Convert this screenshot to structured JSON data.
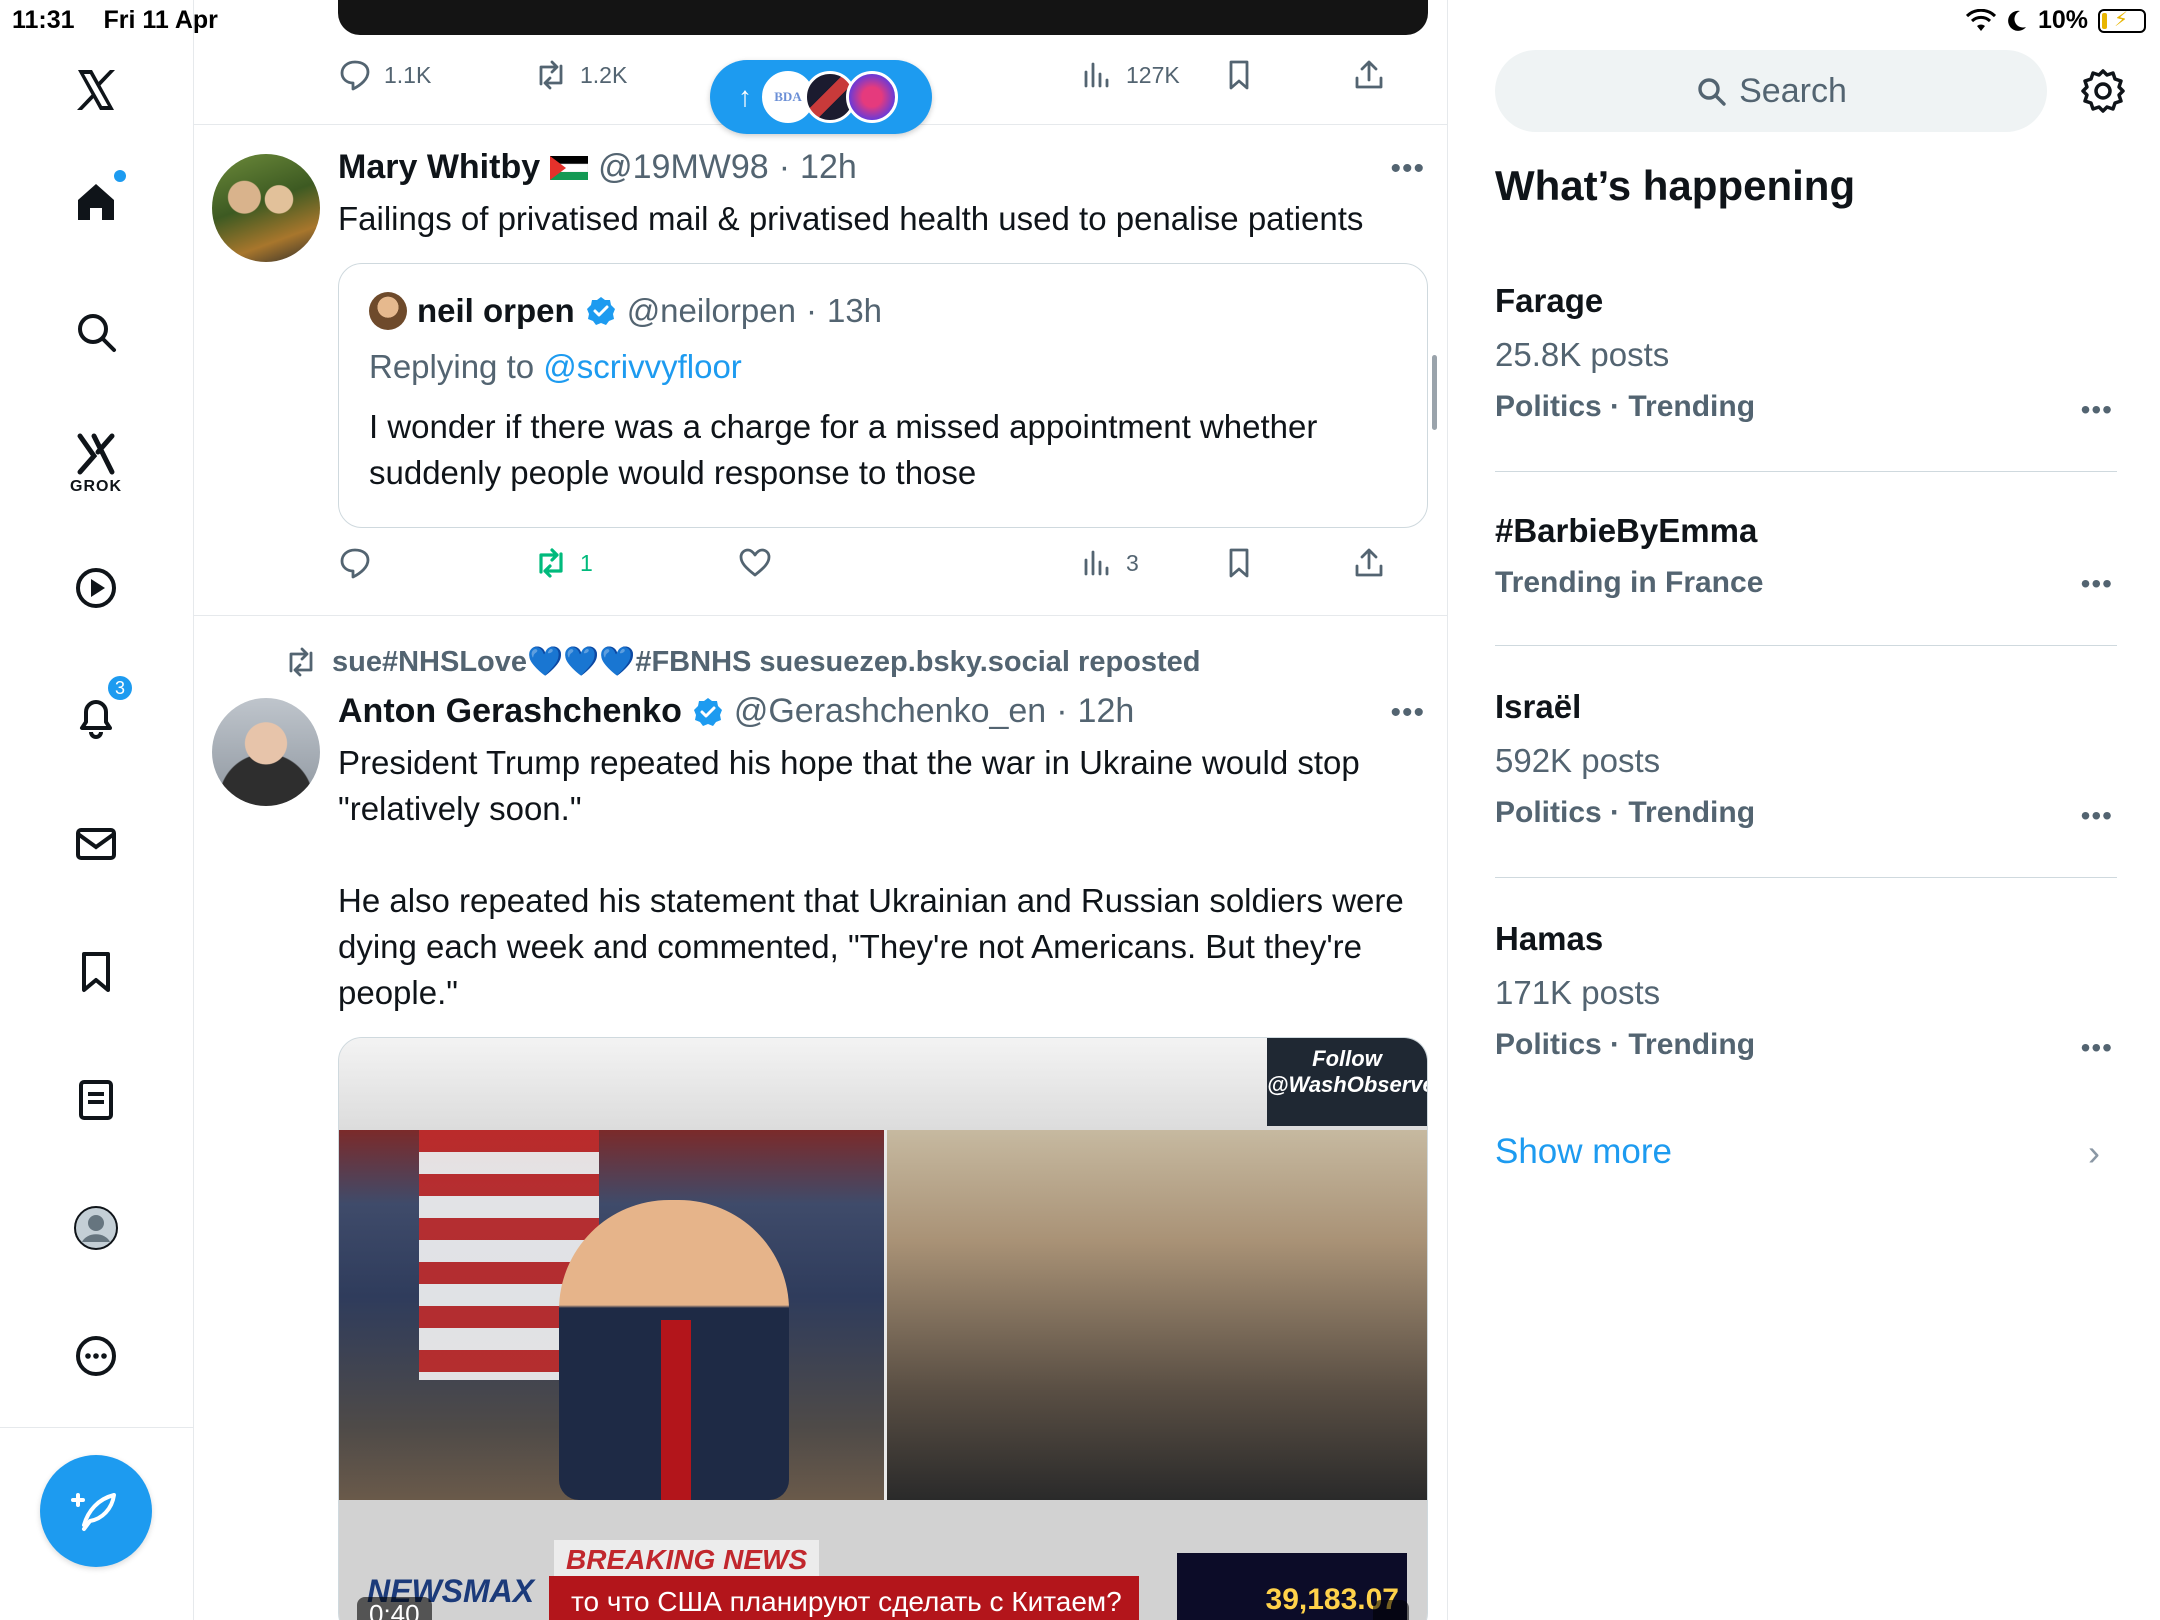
{
  "status_bar": {
    "time": "11:31",
    "date": "Fri 11 Apr",
    "battery": "10%"
  },
  "nav": {
    "grok_label": "GROK",
    "notifications_badge": "3",
    "items": [
      "home-icon",
      "search-icon",
      "grok-icon",
      "video-icon",
      "bell-icon",
      "mail-icon",
      "bookmark-icon",
      "lists-icon",
      "profile-icon",
      "more-icon"
    ]
  },
  "feed": {
    "top_actions": {
      "replies": "1.1K",
      "reposts": "1.2K",
      "views": "127K"
    },
    "tweet1": {
      "name": "Mary Whitby",
      "handle": "@19MW98",
      "time": "12h",
      "text": "Failings of privatised mail & privatised health used to penalise patients",
      "quote": {
        "name": "neil orpen",
        "handle": "@neilorpen",
        "time": "13h",
        "replying_prefix": "Replying to",
        "replying_to": "@scrivvyfloor",
        "text": "I wonder if there was a charge for a missed appointment whether suddenly people would response to those"
      },
      "actions": {
        "reposts": "1",
        "views": "3"
      }
    },
    "tweet2": {
      "repost_by": "sue#NHSLove💙💙💙#FBNHS suesuezep.bsky.social reposted",
      "name": "Anton Gerashchenko",
      "handle": "@Gerashchenko_en",
      "time": "12h",
      "text_p1": "President Trump repeated his hope that the war in Ukraine would stop \"relatively soon.\"",
      "text_p2": "He also repeated his statement that Ukrainian and Russian soldiers were dying each week and commented, \"They're not Americans. But they're people.\"",
      "media": {
        "breaking": "BREAKING NEWS",
        "network": "NEWSMAX",
        "chyron": "то что США планируют сделать с Китаем?",
        "ticker": "39,183.07",
        "follow": "Follow @WashObserver",
        "duration": "0:40"
      }
    }
  },
  "new_posts_pill": {
    "avatar1": "BDA"
  },
  "sidebar": {
    "search_placeholder": "Search",
    "title": "What’s happening",
    "trends": [
      {
        "name": "Farage",
        "count": "25.8K posts",
        "meta": "Politics · Trending"
      },
      {
        "name": "#BarbieByEmma",
        "count": "",
        "meta": "Trending in France"
      },
      {
        "name": "Israël",
        "count": "592K posts",
        "meta": "Politics · Trending"
      },
      {
        "name": "Hamas",
        "count": "171K posts",
        "meta": "Politics · Trending"
      }
    ],
    "show_more": "Show more"
  },
  "colors": {
    "accent": "#1d9bf0",
    "secondary_text": "#536471",
    "repost_green": "#00ba7c"
  }
}
